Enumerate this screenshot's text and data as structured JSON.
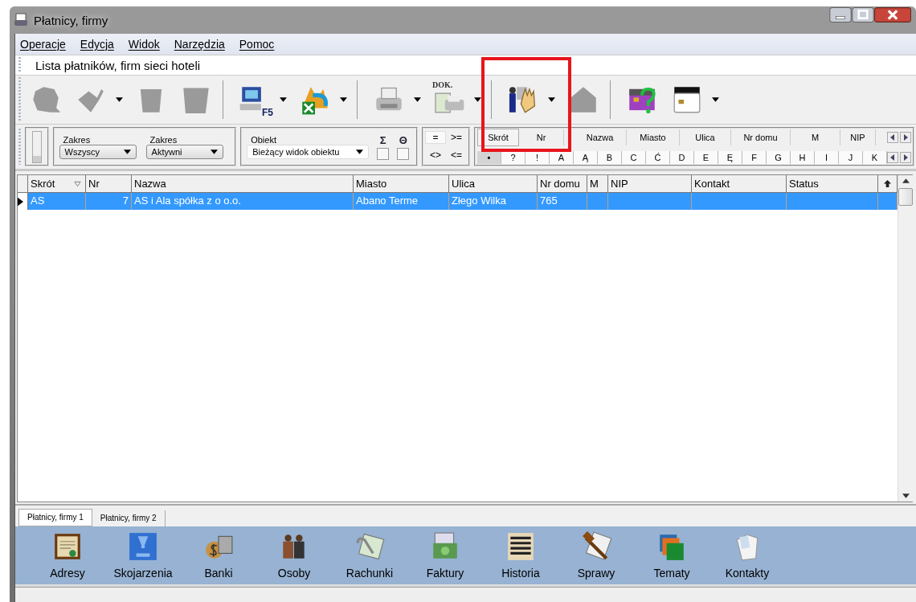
{
  "window": {
    "title": "Płatnicy, firmy"
  },
  "menu": [
    {
      "label": "Operacje"
    },
    {
      "label": "Edycja"
    },
    {
      "label": "Widok"
    },
    {
      "label": "Narzędzia"
    },
    {
      "label": "Pomoc"
    }
  ],
  "caption": "Lista płatników, firm sieci hoteli",
  "toolbar": {
    "groups": [
      {
        "buttons": [
          {
            "disabled": true,
            "dropdown": false
          },
          {
            "disabled": true,
            "dropdown": true
          },
          {
            "disabled": true,
            "dropdown": false
          },
          {
            "disabled": true,
            "dropdown": false
          }
        ]
      },
      {
        "buttons": [
          {
            "disabled": false,
            "dropdown": true,
            "icon_text": "F5"
          },
          {
            "disabled": false,
            "dropdown": true
          }
        ]
      },
      {
        "buttons": [
          {
            "disabled": false,
            "dropdown": true
          },
          {
            "disabled": false,
            "dropdown": true,
            "icon_text": "DOK."
          }
        ]
      },
      {
        "buttons": [
          {
            "disabled": false,
            "dropdown": true
          },
          {
            "disabled": true,
            "dropdown": false
          }
        ]
      },
      {
        "buttons": [
          {
            "disabled": false,
            "dropdown": false
          },
          {
            "disabled": false,
            "dropdown": true
          }
        ]
      }
    ]
  },
  "filters": {
    "scope": [
      {
        "label": "Zakres",
        "value": "Wszyscy"
      },
      {
        "label": "Zakres",
        "value": "Aktywni"
      }
    ],
    "object": {
      "label": "Obiekt",
      "value": "Bieżący widok obiektu"
    },
    "toggles": [
      {
        "label": "Σ",
        "checked": false
      },
      {
        "label": "Θ",
        "checked": false
      }
    ],
    "operators": [
      {
        "label": "=",
        "selected": true
      },
      {
        "label": ">=",
        "selected": false
      },
      {
        "label": "<>",
        "selected": false
      },
      {
        "label": "<=",
        "selected": false
      }
    ],
    "fields": [
      {
        "label": "Skrót",
        "selected": true
      },
      {
        "label": "Nr",
        "selected": false
      },
      {
        "label": "Nazwa",
        "selected": false
      },
      {
        "label": "Miasto",
        "selected": false
      },
      {
        "label": "Ulica",
        "selected": false
      },
      {
        "label": "Nr domu",
        "selected": false
      },
      {
        "label": "M",
        "selected": false
      },
      {
        "label": "NIP",
        "selected": false
      }
    ],
    "letters": [
      {
        "label": "•",
        "selected": true
      },
      {
        "label": "?",
        "selected": false
      },
      {
        "label": "!",
        "selected": false
      },
      {
        "label": "A",
        "selected": false
      },
      {
        "label": "Ą",
        "selected": false
      },
      {
        "label": "B",
        "selected": false
      },
      {
        "label": "C",
        "selected": false
      },
      {
        "label": "Ć",
        "selected": false
      },
      {
        "label": "D",
        "selected": false
      },
      {
        "label": "E",
        "selected": false
      },
      {
        "label": "Ę",
        "selected": false
      },
      {
        "label": "F",
        "selected": false
      },
      {
        "label": "G",
        "selected": false
      },
      {
        "label": "H",
        "selected": false
      },
      {
        "label": "I",
        "selected": false
      },
      {
        "label": "J",
        "selected": false
      },
      {
        "label": "K",
        "selected": false
      }
    ]
  },
  "table": {
    "columns": [
      "Skrót",
      "Nr",
      "Nazwa",
      "Miasto",
      "Ulica",
      "Nr domu",
      "M",
      "NIP",
      "Kontakt",
      "Status"
    ],
    "rows": [
      {
        "selected": true,
        "cells": [
          "AS",
          "7",
          "AS i Ala spółka z o o.o.",
          "Abano Terme",
          "Złego Wilka",
          "765",
          "",
          "",
          "",
          ""
        ]
      }
    ]
  },
  "tabs": [
    {
      "label": "Płatnicy, firmy 1",
      "selected": true
    },
    {
      "label": "Płatnicy, firmy 2",
      "selected": false
    }
  ],
  "shortcuts": [
    {
      "label": "Adresy"
    },
    {
      "label": "Skojarzenia"
    },
    {
      "label": "Banki"
    },
    {
      "label": "Osoby"
    },
    {
      "label": "Rachunki"
    },
    {
      "label": "Faktury"
    },
    {
      "label": "Historia"
    },
    {
      "label": "Sprawy"
    },
    {
      "label": "Tematy"
    },
    {
      "label": "Kontakty"
    }
  ]
}
